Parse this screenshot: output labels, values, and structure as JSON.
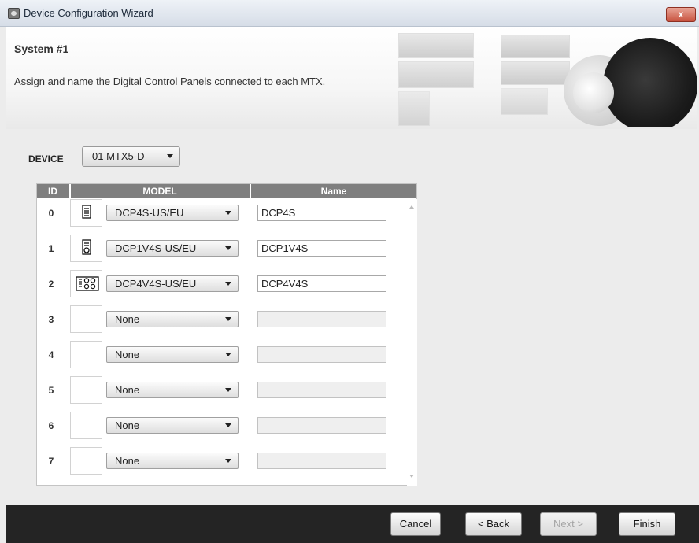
{
  "window": {
    "title": "Device Configuration Wizard",
    "close_label": "x"
  },
  "header": {
    "system_title": "System #1",
    "instruction": "Assign and name the Digital Control Panels connected to each MTX."
  },
  "device": {
    "label": "DEVICE",
    "selected": "01 MTX5-D"
  },
  "table": {
    "headers": {
      "id": "ID",
      "model": "MODEL",
      "name": "Name"
    },
    "rows": [
      {
        "id": "0",
        "model": "DCP4S-US/EU",
        "name": "DCP4S",
        "icon": "dcp4s-panel-icon"
      },
      {
        "id": "1",
        "model": "DCP1V4S-US/EU",
        "name": "DCP1V4S",
        "icon": "dcp1v4s-panel-icon"
      },
      {
        "id": "2",
        "model": "DCP4V4S-US/EU",
        "name": "DCP4V4S",
        "icon": "dcp4v4s-panel-icon"
      },
      {
        "id": "3",
        "model": "None",
        "name": ""
      },
      {
        "id": "4",
        "model": "None",
        "name": ""
      },
      {
        "id": "5",
        "model": "None",
        "name": ""
      },
      {
        "id": "6",
        "model": "None",
        "name": ""
      },
      {
        "id": "7",
        "model": "None",
        "name": ""
      }
    ]
  },
  "buttons": {
    "cancel": "Cancel",
    "back": "< Back",
    "next": "Next >",
    "finish": "Finish"
  },
  "colors": {
    "header_bg": "#7f7f7f",
    "bottom_bar": "#242424",
    "close_button": "#c8533f"
  }
}
